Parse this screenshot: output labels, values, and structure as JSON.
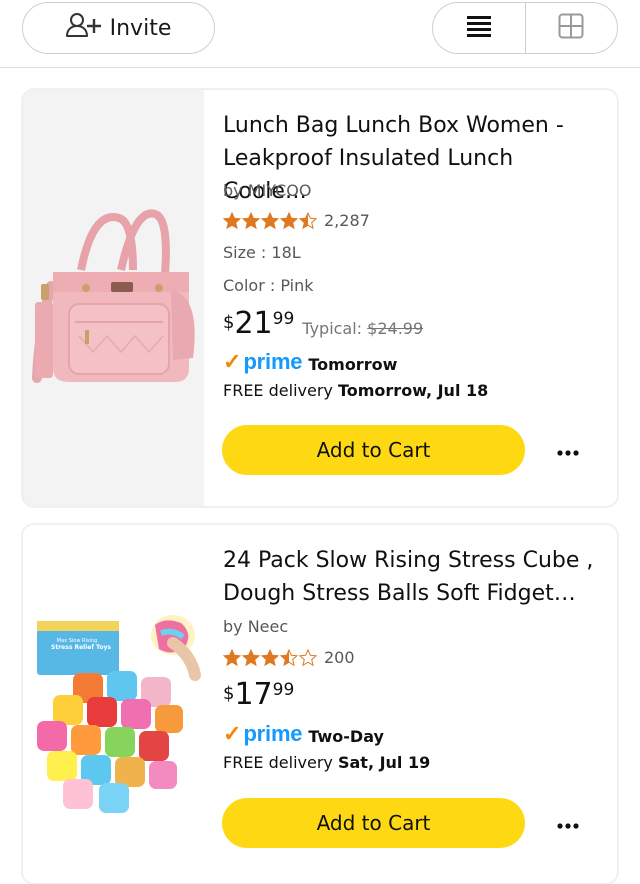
{
  "header": {
    "invite_label": "Invite",
    "view_options": [
      "list-view",
      "grid-view"
    ]
  },
  "products": [
    {
      "title_line1": "Lunch Bag Lunch Box Women -",
      "title_line2": "Leakproof Insulated Lunch Coole…",
      "brand": "by MIYCOO",
      "stars": 4.5,
      "rating_count": "2,287",
      "size": "Size : 18L",
      "color": "Color : Pink",
      "price_symbol": "$",
      "price_whole": "21",
      "price_fraction": "99",
      "typical_label": "Typical:",
      "typical_price": "$24.99",
      "prime_label": "prime",
      "prime_speed": "Tomorrow",
      "delivery_prefix": "FREE delivery",
      "delivery_date": "Tomorrow, Jul 18",
      "add_to_cart": "Add to Cart"
    },
    {
      "title_line1": "24 Pack Slow Rising Stress Cube ,",
      "title_line2": "Dough Stress Balls Soft Fidget…",
      "brand": "by Neec",
      "stars": 3.5,
      "rating_count": "200",
      "price_symbol": "$",
      "price_whole": "17",
      "price_fraction": "99",
      "prime_label": "prime",
      "prime_speed": "Two-Day",
      "delivery_prefix": "FREE delivery",
      "delivery_date": "Sat, Jul 19",
      "box_text_line1": "Max Slow Rising",
      "box_text_line2": "Stress Relief Toys",
      "add_to_cart": "Add to Cart"
    }
  ],
  "colors": {
    "cart_button": "#ffd814",
    "star": "#de7921",
    "prime_blue": "#1399ff",
    "prime_check": "#f08804"
  }
}
